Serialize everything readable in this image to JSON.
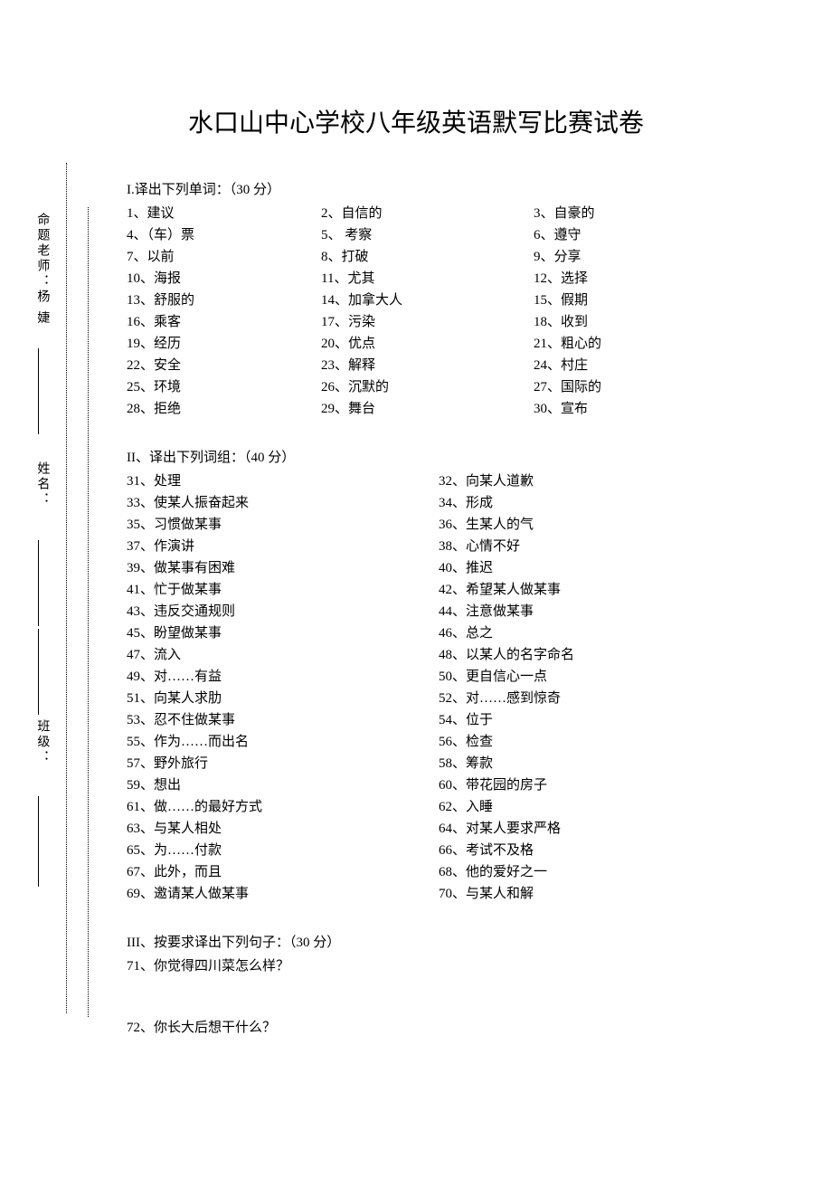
{
  "title": "水口山中心学校八年级英语默写比赛试卷",
  "sidebar": {
    "teacher": "命题老师：杨   婕",
    "name": "姓名：",
    "class": "班级："
  },
  "section1": {
    "head": "I.译出下列单词：（30 分）",
    "items": [
      [
        "1、建议",
        "2、自信的",
        "3、自豪的"
      ],
      [
        "4、（车）票",
        "5、  考察",
        "6、遵守"
      ],
      [
        "7、以前",
        "8、打破",
        "9、分享"
      ],
      [
        "10、海报",
        "11、尤其",
        "12、选择"
      ],
      [
        "13、舒服的",
        "14、加拿大人",
        "15、假期"
      ],
      [
        "16、乘客",
        "17、污染",
        "18、收到"
      ],
      [
        "19、经历",
        "20、优点",
        "21、粗心的"
      ],
      [
        "22、安全",
        "23、解释",
        "24、村庄"
      ],
      [
        "25、环境",
        "26、沉默的",
        "27、国际的"
      ],
      [
        "28、拒绝",
        "29、舞台",
        "30、宣布"
      ]
    ]
  },
  "section2": {
    "head": "II、译出下列词组：（40 分）",
    "items": [
      [
        "31、处理",
        "32、向某人道歉"
      ],
      [
        "33、使某人振奋起来",
        "34、形成"
      ],
      [
        "35、习惯做某事",
        "36、生某人的气"
      ],
      [
        "37、作演讲",
        "38、心情不好"
      ],
      [
        "39、做某事有困难",
        "40、推迟"
      ],
      [
        "41、忙于做某事",
        "42、希望某人做某事"
      ],
      [
        "43、违反交通规则",
        "44、注意做某事"
      ],
      [
        "45、盼望做某事",
        "46、总之"
      ],
      [
        "47、流入",
        "48、以某人的名字命名"
      ],
      [
        "49、对……有益",
        "50、更自信心一点"
      ],
      [
        "51、向某人求肋",
        "52、对……感到惊奇"
      ],
      [
        "53、忍不住做某事",
        "54、位于"
      ],
      [
        "55、作为……而出名",
        "56、检查"
      ],
      [
        "57、野外旅行",
        "58、筹款"
      ],
      [
        "59、想出",
        "60、带花园的房子"
      ],
      [
        "61、做……的最好方式",
        "62、入睡"
      ],
      [
        "63、与某人相处",
        "64、对某人要求严格"
      ],
      [
        "65、为……付款",
        "66、考试不及格"
      ],
      [
        "67、此外，而且",
        "68、他的爱好之一"
      ],
      [
        "69、邀请某人做某事",
        "70、与某人和解"
      ]
    ]
  },
  "section3": {
    "head": "III、按要求译出下列句子：（30 分）",
    "q71": "71、你觉得四川菜怎么样？",
    "q72": "72、你长大后想干什么？"
  }
}
